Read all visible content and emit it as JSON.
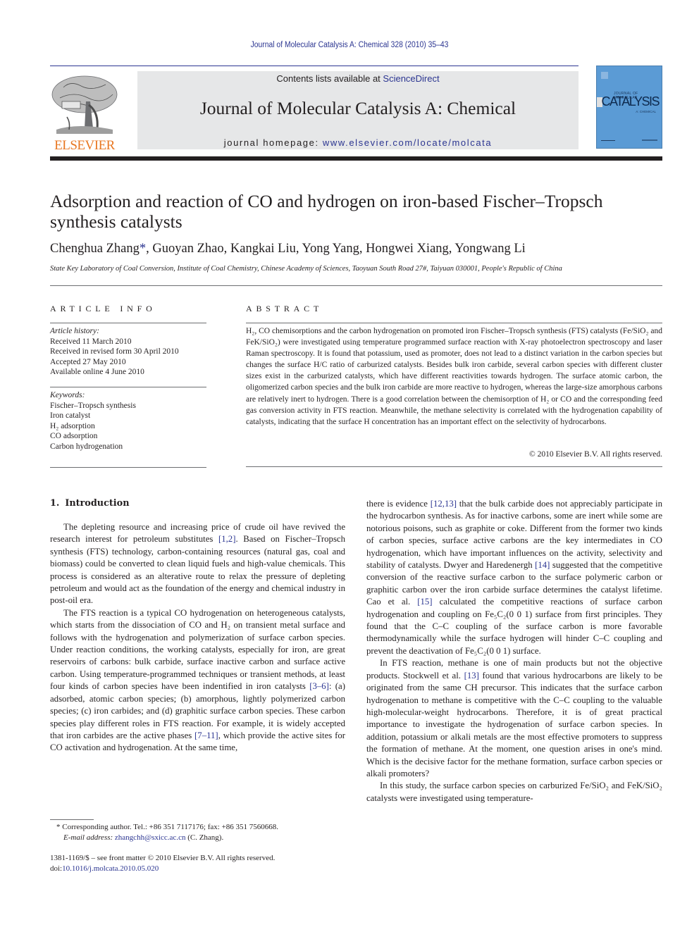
{
  "running_head": "Journal of Molecular Catalysis A: Chemical 328 (2010) 35–43",
  "masthead": {
    "contents_prefix": "Contents lists available at ",
    "contents_link": "ScienceDirect",
    "journal_name": "Journal of Molecular Catalysis A: Chemical",
    "homepage_prefix": "journal homepage: ",
    "homepage_link": "www.elsevier.com/locate/molcata",
    "publisher_logo_text": "ELSEVIER",
    "cover": {
      "small_text": "JOURNAL OF MOLECULAR",
      "big_text": "CATALYSIS",
      "sub_text": "A: CHEMICAL"
    }
  },
  "colors": {
    "link": "#2b3591",
    "elsevier_orange": "#e87722",
    "masthead_gray": "#e6e7e8",
    "cover_blue": "#5b9bd5",
    "text": "#231f20"
  },
  "article": {
    "title": "Adsorption and reaction of CO and hydrogen on iron-based Fischer–Tropsch synthesis catalysts",
    "authors": [
      {
        "name": "Chenghua Zhang",
        "corresponding": true
      },
      {
        "name": "Guoyan Zhao"
      },
      {
        "name": "Kangkai Liu"
      },
      {
        "name": "Yong Yang"
      },
      {
        "name": "Hongwei Xiang"
      },
      {
        "name": "Yongwang Li"
      }
    ],
    "corresponding_mark": "*",
    "affiliation": "State Key Laboratory of Coal Conversion, Institute of Coal Chemistry, Chinese Academy of Sciences, Taoyuan South Road 27#, Taiyuan 030001, People's Republic of China"
  },
  "article_info": {
    "heading": "ARTICLE INFO",
    "history_label": "Article history:",
    "history": [
      "Received 11 March 2010",
      "Received in revised form 30 April 2010",
      "Accepted 27 May 2010",
      "Available online 4 June 2010"
    ],
    "keywords_label": "Keywords:",
    "keywords": [
      "Fischer–Tropsch synthesis",
      "Iron catalyst",
      "H₂ adsorption",
      "CO adsorption",
      "Carbon hydrogenation"
    ]
  },
  "abstract": {
    "heading": "ABSTRACT",
    "text": "H₂, CO chemisorptions and the carbon hydrogenation on promoted iron Fischer–Tropsch synthesis (FTS) catalysts (Fe/SiO₂ and FeK/SiO₂) were investigated using temperature programmed surface reaction with X-ray photoelectron spectroscopy and laser Raman spectroscopy. It is found that potassium, used as promoter, does not lead to a distinct variation in the carbon species but changes the surface H/C ratio of carburized catalysts. Besides bulk iron carbide, several carbon species with different cluster sizes exist in the carburized catalysts, which have different reactivities towards hydrogen. The surface atomic carbon, the oligomerized carbon species and the bulk iron carbide are more reactive to hydrogen, whereas the large-size amorphous carbons are relatively inert to hydrogen. There is a good correlation between the chemisorption of H₂ or CO and the corresponding feed gas conversion activity in FTS reaction. Meanwhile, the methane selectivity is correlated with the hydrogenation capability of catalysts, indicating that the surface H concentration has an important effect on the selectivity of hydrocarbons.",
    "copyright": "© 2010 Elsevier B.V. All rights reserved."
  },
  "introduction": {
    "number": "1.",
    "title": "Introduction",
    "left_paragraphs": [
      [
        {
          "t": "The depleting resource and increasing price of crude oil have revived the research interest for petroleum substitutes "
        },
        {
          "ref": "[1,2]"
        },
        {
          "t": ". Based on Fischer–Tropsch synthesis (FTS) technology, carbon-containing resources (natural gas, coal and biomass) could be converted to clean liquid fuels and high-value chemicals. This process is considered as an alterative route to relax the pressure of depleting petroleum and would act as the foundation of the energy and chemical industry in post-oil era."
        }
      ],
      [
        {
          "t": "The FTS reaction is a typical CO hydrogenation on heterogeneous catalysts, which starts from the dissociation of CO and H₂ on transient metal surface and follows with the hydrogenation and polymerization of surface carbon species. Under reaction conditions, the working catalysts, especially for iron, are great reservoirs of carbons: bulk carbide, surface inactive carbon and surface active carbon. Using temperature-programmed techniques or transient methods, at least four kinds of carbon species have been indentified in iron catalysts "
        },
        {
          "ref": "[3–6]"
        },
        {
          "t": ": (a) adsorbed, atomic carbon species; (b) amorphous, lightly polymerized carbon species; (c) iron carbides; and (d) graphitic surface carbon species. These carbon species play different roles in FTS reaction. For example, it is widely accepted that iron carbides are the active phases "
        },
        {
          "ref": "[7–11]"
        },
        {
          "t": ", which provide the active sites for CO activation and hydrogenation. At the same time,"
        }
      ]
    ],
    "right_paragraphs": [
      [
        {
          "t": "there is evidence "
        },
        {
          "ref": "[12,13]"
        },
        {
          "t": " that the bulk carbide does not appreciably participate in the hydrocarbon synthesis. As for inactive carbons, some are inert while some are notorious poisons, such as graphite or coke. Different from the former two kinds of carbon species, surface active carbons are the key intermediates in CO hydrogenation, which have important influences on the activity, selectivity and stability of catalysts. Dwyer and Haredenergh "
        },
        {
          "ref": "[14]"
        },
        {
          "t": " suggested that the competitive conversion of the reactive surface carbon to the surface polymeric carbon or graphitic carbon over the iron carbide surface determines the catalyst lifetime. Cao et al. "
        },
        {
          "ref": "[15]"
        },
        {
          "t": " calculated the competitive reactions of surface carbon hydrogenation and coupling on Fe₅C₂(0 0 1) surface from first principles. They found that the C–C coupling of the surface carbon is more favorable thermodynamically while the surface hydrogen will hinder C–C coupling and prevent the deactivation of Fe₅C₂(0 0 1) surface."
        }
      ],
      [
        {
          "t": "In FTS reaction, methane is one of main products but not the objective products. Stockwell et al. "
        },
        {
          "ref": "[13]"
        },
        {
          "t": " found that various hydrocarbons are likely to be originated from the same CH precursor. This indicates that the surface carbon hydrogenation to methane is competitive with the C–C coupling to the valuable high-molecular-weight hydrocarbons. Therefore, it is of great practical importance to investigate the hydrogenation of surface carbon species. In addition, potassium or alkali metals are the most effective promoters to suppress the formation of methane. At the moment, one question arises in one's mind. Which is the decisive factor for the methane formation, surface carbon species or alkali promoters?"
        }
      ],
      [
        {
          "t": "In this study, the surface carbon species on carburized Fe/SiO₂ and FeK/SiO₂ catalysts were investigated using temperature-"
        }
      ]
    ]
  },
  "footnote": {
    "mark": "*",
    "corresponding": "Corresponding author. Tel.: +86 351 7117176; fax: +86 351 7560668.",
    "email_label": "E-mail address:",
    "email": "zhangchh@sxicc.ac.cn",
    "email_suffix": " (C. Zhang)."
  },
  "front_matter": {
    "issn_line": "1381-1169/$ – see front matter © 2010 Elsevier B.V. All rights reserved.",
    "doi_label": "doi:",
    "doi": "10.1016/j.molcata.2010.05.020"
  }
}
